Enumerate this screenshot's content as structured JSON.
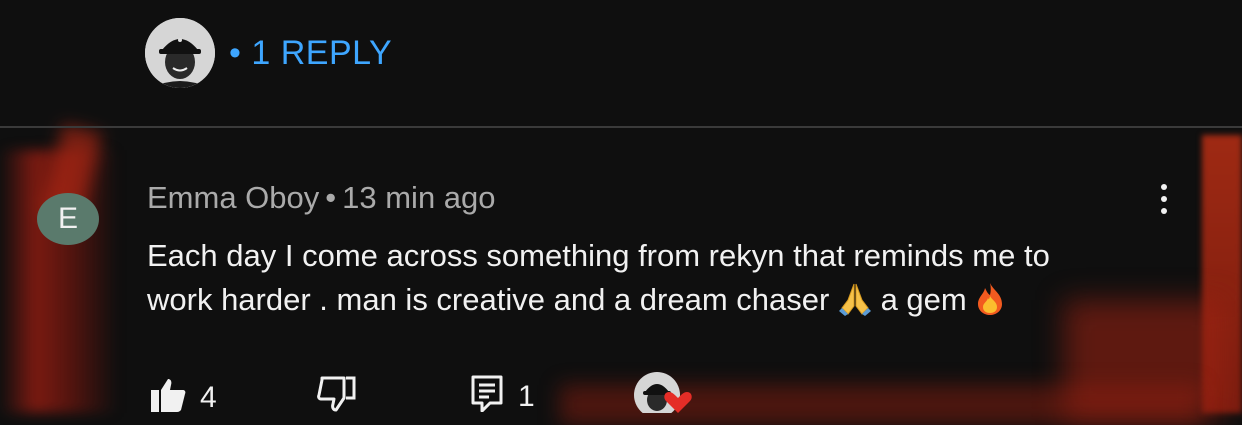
{
  "replies": {
    "bullet": "•",
    "label": "1 REPLY"
  },
  "comment": {
    "author_initial": "E",
    "author": "Emma Oboy",
    "separator": "•",
    "time": "13 min ago",
    "text_line1": "Each day I come across something from rekyn that reminds me to",
    "text_line2_a": "work harder . man is creative and a dream chaser",
    "text_line2_b": "a gem"
  },
  "actions": {
    "like_count": "4",
    "reply_count": "1"
  },
  "icons": {
    "more": "more-vert-icon",
    "like": "thumb-up-icon",
    "dislike": "thumb-down-icon",
    "reply": "comment-icon",
    "praying": "praying-hands-emoji",
    "fire": "fire-emoji",
    "heart": "heart-icon"
  },
  "colors": {
    "background": "#0f0f0f",
    "link": "#3ea6ff",
    "meta": "#aaaaaa",
    "heart": "#e52d27",
    "avatar_bg": "#5a7a6c"
  }
}
